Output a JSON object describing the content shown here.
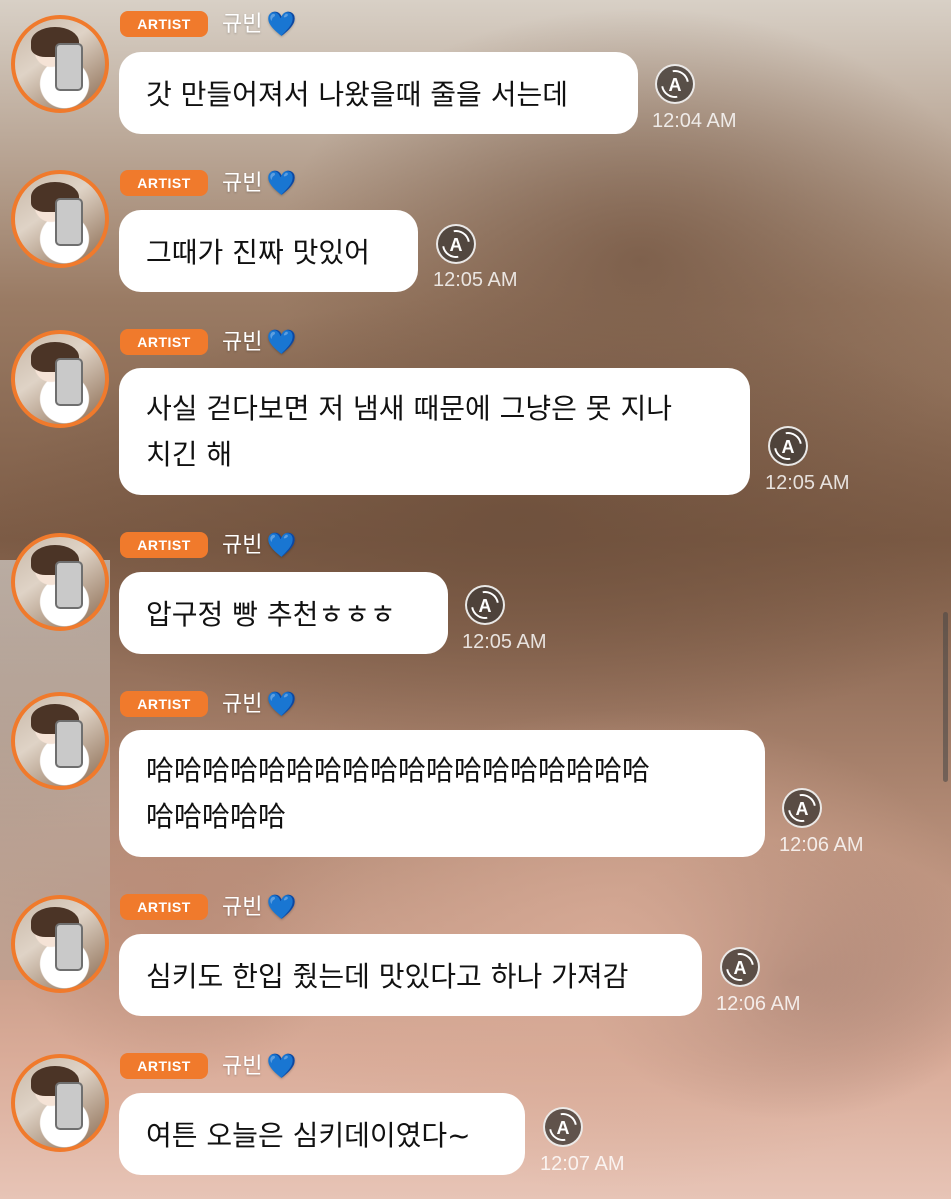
{
  "colors": {
    "artist_badge": "#f07a2c",
    "bubble": "#ffffff",
    "timestamp": "#ffffff",
    "heart": "#79cbef"
  },
  "icons": {
    "heart": "💙",
    "translate": "A"
  },
  "messages": [
    {
      "badge": "ARTIST",
      "sender": "규빈",
      "text": "갓 만들어져서 나왔을때 줄을 서는데",
      "time": "12:04 AM"
    },
    {
      "badge": "ARTIST",
      "sender": "규빈",
      "text": "그때가 진짜 맛있어",
      "time": "12:05 AM"
    },
    {
      "badge": "ARTIST",
      "sender": "규빈",
      "text": "사실 걷다보면 저 냄새 때문에 그냥은 못 지나\n치긴 해",
      "time": "12:05 AM"
    },
    {
      "badge": "ARTIST",
      "sender": "규빈",
      "text": "압구정 빵 추천ㅎㅎㅎ",
      "time": "12:05 AM"
    },
    {
      "badge": "ARTIST",
      "sender": "규빈",
      "text": "哈哈哈哈哈哈哈哈哈哈哈哈哈哈哈哈哈哈\n哈哈哈哈哈",
      "time": "12:06 AM"
    },
    {
      "badge": "ARTIST",
      "sender": "규빈",
      "text": "심키도 한입 줬는데 맛있다고 하나 가져감",
      "time": "12:06 AM"
    },
    {
      "badge": "ARTIST",
      "sender": "규빈",
      "text": "여튼 오늘은 심키데이였다~",
      "time": "12:07 AM"
    }
  ]
}
